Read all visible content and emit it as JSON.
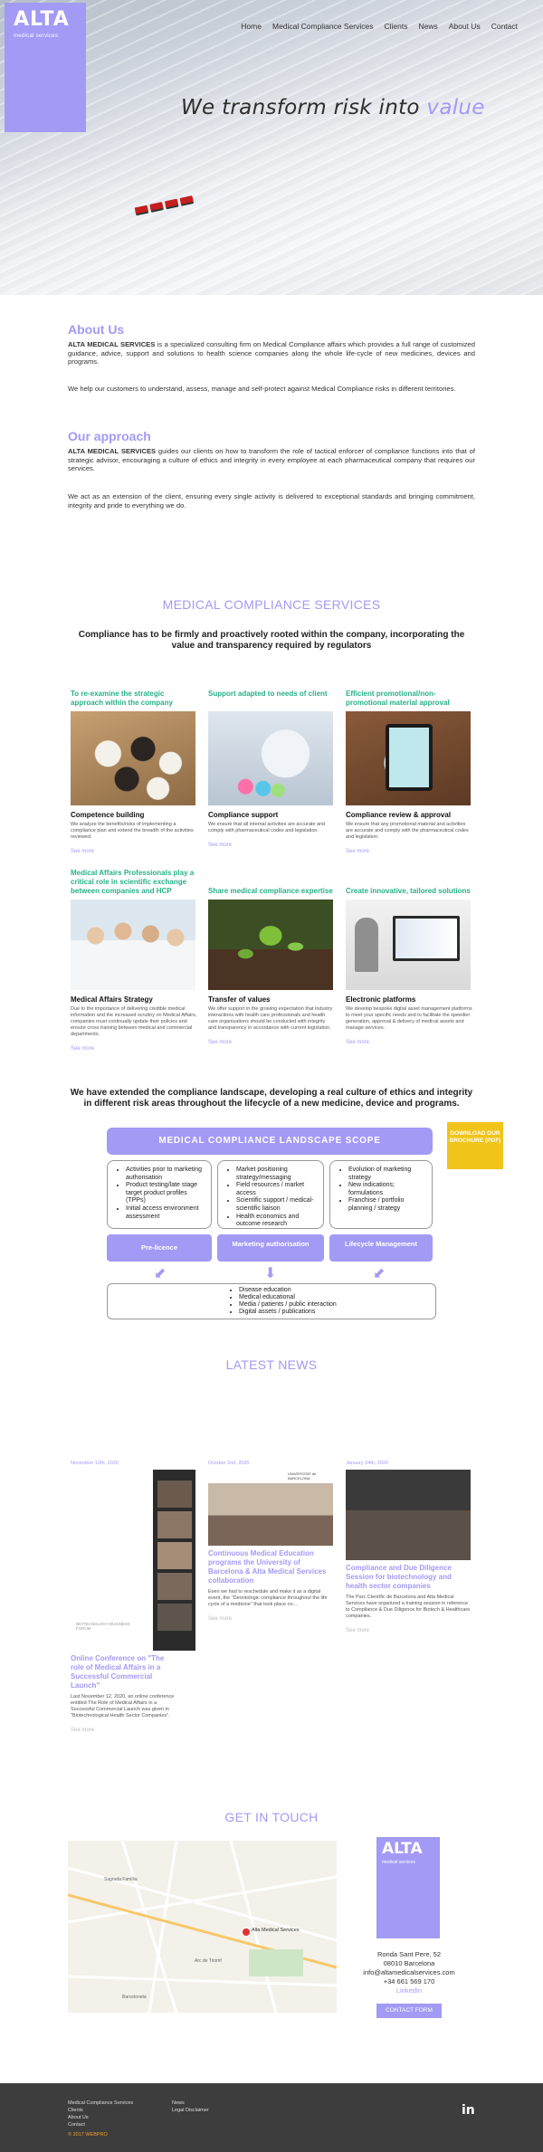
{
  "brand": {
    "name": "ALTA",
    "tagline": "medical services"
  },
  "nav": [
    "Home",
    "Medical Compliance Services",
    "Clients",
    "News",
    "About Us",
    "Contact"
  ],
  "hero": {
    "line": "We transform risk into",
    "highlight": "value"
  },
  "about": {
    "title": "About Us",
    "p1_bold": "ALTA MEDICAL SERVICES",
    "p1": " is a specialized consulting firm on Medical Compliance affairs which provides a full range of customized guidance, advice, support and solutions to health science companies along the whole life-cycle of new medicines, devices and programs.",
    "p2": "We help our customers to understand, assess, manage and self-protect against Medical Compliance risks in different territories."
  },
  "approach": {
    "title": "Our approach",
    "p1_bold": "ALTA MEDICAL SERVICES",
    "p1": " guides our clients on how to transform the role of tactical enforcer of compliance functions into that of strategic advisor, encouraging a culture of ethics and integrity in every employee at each pharmaceutical company that requires our services.",
    "p2": "We act as an extension of the client, ensuring every single activity is delivered to exceptional standards and bringing commitment, integrity and pride to everything we do."
  },
  "services": {
    "title": "MEDICAL COMPLIANCE SERVICES",
    "lead": "Compliance has to be firmly and proactively rooted within the company, incorporating the value and transparency required by regulators",
    "see_more": "See more",
    "cards": [
      {
        "tag": "To re-examine the strategic approach within the company",
        "name": "Competence building",
        "desc": "We analyze the benefits/risks of implementing a compliance plan and extend the breadth of the activities reviewed."
      },
      {
        "tag": "Support adapted to needs of client",
        "name": "Compliance support",
        "desc": "We ensure that all internal activities are accurate and comply with pharmaceutical codes and legislation."
      },
      {
        "tag": "Efficient promotional/non-promotional material approval",
        "name": "Compliance review & approval",
        "desc": "We ensure that any promotional material and activities are accurate and comply with the pharmaceutical codes and legislation."
      },
      {
        "tag": "Medical Affairs Professionals play a critical role in scientific exchange between companies and HCP",
        "name": "Medical Affairs Strategy",
        "desc": "Due to the importance of delivering credible medical information and the increased scrutiny on Medical Affairs, companies must continually update their policies and ensure cross training between medical and commercial departments."
      },
      {
        "tag": "Share medical compliance expertise",
        "name": "Transfer of values",
        "desc": "We offer support in the growing expectation that industry interactions with health care professionals and health care organizations should be conducted with integrity and transparency in accordance with current legislation."
      },
      {
        "tag": "Create innovative, tailored solutions",
        "name": "Electronic platforms",
        "desc": "We develop bespoke digital asset management platforms to meet your specific needs and to facilitate the speedier generation, approval & delivery of medical assets and manage services."
      }
    ]
  },
  "scope": {
    "lead": "We have extended the compliance landscape, developing a real culture of ethics and integrity in different risk areas throughout the lifecycle of a new medicine, device and programs.",
    "bar": "MEDICAL COMPLIANCE LANDSCAPE SCOPE",
    "download": "DOWNLOAD OUR BROCHURE (PDF)",
    "col1": [
      "Activities prior to marketing authorisation",
      "Product testing/late stage target product profiles (TPPs)",
      "Initial access environment assessment"
    ],
    "col2": [
      "Market positioning strategy/messaging",
      "Field resources / market access",
      "Scientific support / medical-scientific liaison",
      "Health economics and outcome research"
    ],
    "col3": [
      "Evolution of marketing strategy",
      "New indications; formulations",
      "Franchise / portfolio planning / strategy"
    ],
    "btn1": "Pre-licence",
    "btn2": "Marketing authorisation",
    "btn3": "Lifecycle Management",
    "bottom": [
      "Disease education",
      "Medical educational",
      "Media / patients / public interaction",
      "Digital assets / publications"
    ]
  },
  "news": {
    "title": "LATEST NEWS",
    "see_more": "See more",
    "items": [
      {
        "date": "November 12th, 2020",
        "title": "Online Conference on \"The role of Medical Affairs in a Successful Commercial Launch\"",
        "desc": "Last November 12, 2020, an online conference entitled The Role of Medical Affairs in a Successful Commercial Launch was given in \"Biotechnological Health Sector Companies\"."
      },
      {
        "date": "October 2nd, 2020",
        "title": "Continuous Medical Education programs the University of Barcelona & Alta Medical Services collaboration",
        "desc": "Even we had to reschedule and make it as a digital event, the \"Deontologic compliance throughout the life cycle of a medicine\" that took place on..."
      },
      {
        "date": "January 24th, 2020",
        "title": "Compliance and Due Diligence Session for biotechnology and health sector companies",
        "desc": "The Parc Científic de Barcelona and Alta Medical Services have organized a training session in reference to Compliance & Due Diligence for Biotech & Healthcare companies."
      }
    ],
    "logo1": "UNIVERSITAT de BARCELONA",
    "logo2": "BIOTECNOLOGY BUSINESS FORUM"
  },
  "contact": {
    "title": "GET IN TOUCH",
    "address": [
      "Ronda Sant Pere, 52",
      "08010 Barcelona",
      "info@altamedicalservices.com",
      "+34 661 569 170"
    ],
    "linkedin": "LinkedIn",
    "button": "CONTACT FORM",
    "map_pin": "Alta Medical Services",
    "map_labels": [
      "Sagrada Família",
      "Arc de Triomf",
      "Barceloneta"
    ]
  },
  "footer": {
    "col1": [
      "Medical Compliance Services",
      "Clients",
      "About Us",
      "Contact"
    ],
    "col2": [
      "News",
      "Legal Disclaimer"
    ],
    "copyright": "© 2017 WEBPRO",
    "social": "in"
  },
  "colors": {
    "accent": "#a29af5",
    "green": "#27b08a",
    "yellow": "#f0c419",
    "footer": "#3d3d3d"
  }
}
